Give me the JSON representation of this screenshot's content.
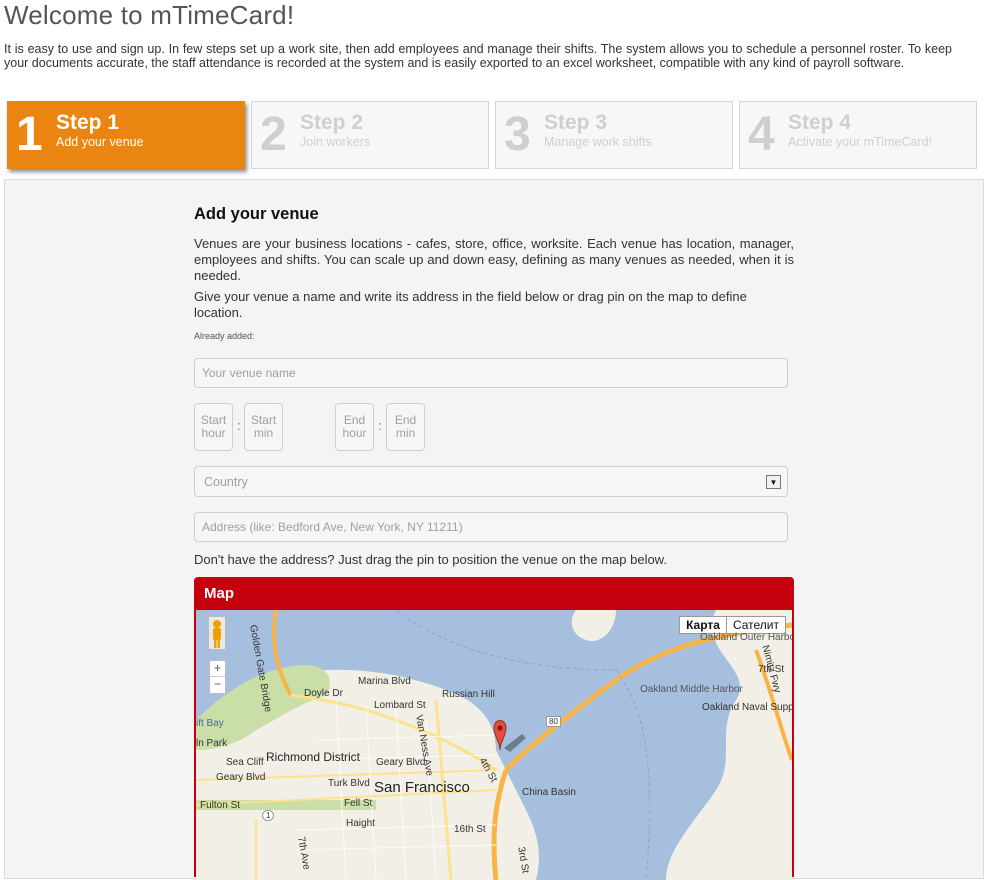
{
  "page_title": "Welcome to mTimeCard!",
  "intro": "It is easy to use and sign up. In few steps set up a work site, then add employees and manage their shifts. The system allows you to schedule a personnel roster. To keep your documents accurate, the staff attendance is recorded at the system and is easily exported to an excel worksheet, compatible with any kind of payroll software.",
  "steps": [
    {
      "num": "1",
      "title": "Step 1",
      "sub": "Add your venue",
      "active": true
    },
    {
      "num": "2",
      "title": "Step 2",
      "sub": "Join workers",
      "active": false
    },
    {
      "num": "3",
      "title": "Step 3",
      "sub": "Manage work shifts",
      "active": false
    },
    {
      "num": "4",
      "title": "Step 4",
      "sub": "Activate your mTimeCard!",
      "active": false
    }
  ],
  "form": {
    "heading": "Add your venue",
    "para1": "Venues are your business locations - cafes, store, office, worksite. Each venue has location, manager, employees and shifts. You can scale up and down easy, defining as many venues as needed, when it is needed.",
    "para2": "Give your venue a name and write its address in the field below or drag pin on the map to define location.",
    "already_added": "Already added:",
    "venue_placeholder": "Your venue name",
    "start_hour": "Start hour",
    "start_min": "Start min",
    "end_hour": "End hour",
    "end_min": "End min",
    "colon": ":",
    "country_value": "Country",
    "address_placeholder": "Address (like: Bedford Ave, New York, NY 11211)",
    "hint": "Don't have the address? Just drag the pin to position the venue on the map below."
  },
  "map": {
    "title": "Map",
    "type_map": "Карта",
    "type_satellite": "Сателит",
    "zoom_in": "+",
    "zoom_out": "−",
    "labels": {
      "golden_gate": "Golden Gate Bridge",
      "russian_hill": "Russian Hill",
      "marina": "Marina Blvd",
      "doyle": "Doyle Dr",
      "lombard": "Lombard St",
      "van_ness": "Van Ness Ave",
      "richmond": "Richmond District",
      "sea_cliff": "Sea Cliff",
      "geary": "Geary Blvd",
      "geary2": "Geary Blvd",
      "turk": "Turk Blvd",
      "san_francisco": "San Francisco",
      "fell": "Fell St",
      "fulton": "Fulton St",
      "haight": "Haight",
      "china_basin": "China Basin",
      "oakland": "Oakland Middle Harbor",
      "oakland_supply": "Oakland Naval Supply Center",
      "oakland_outer": "Oakland Outer Harbor",
      "bay": "ift Bay",
      "park": "ln Park",
      "fourth": "4th St",
      "seventh": "7th St",
      "sixteenth": "16th St",
      "hwy80": "80",
      "hwy1": "1",
      "third": "3rd St",
      "seventh_ave": "7th Ave",
      "nimitz": "Nimitz Fwy"
    }
  }
}
